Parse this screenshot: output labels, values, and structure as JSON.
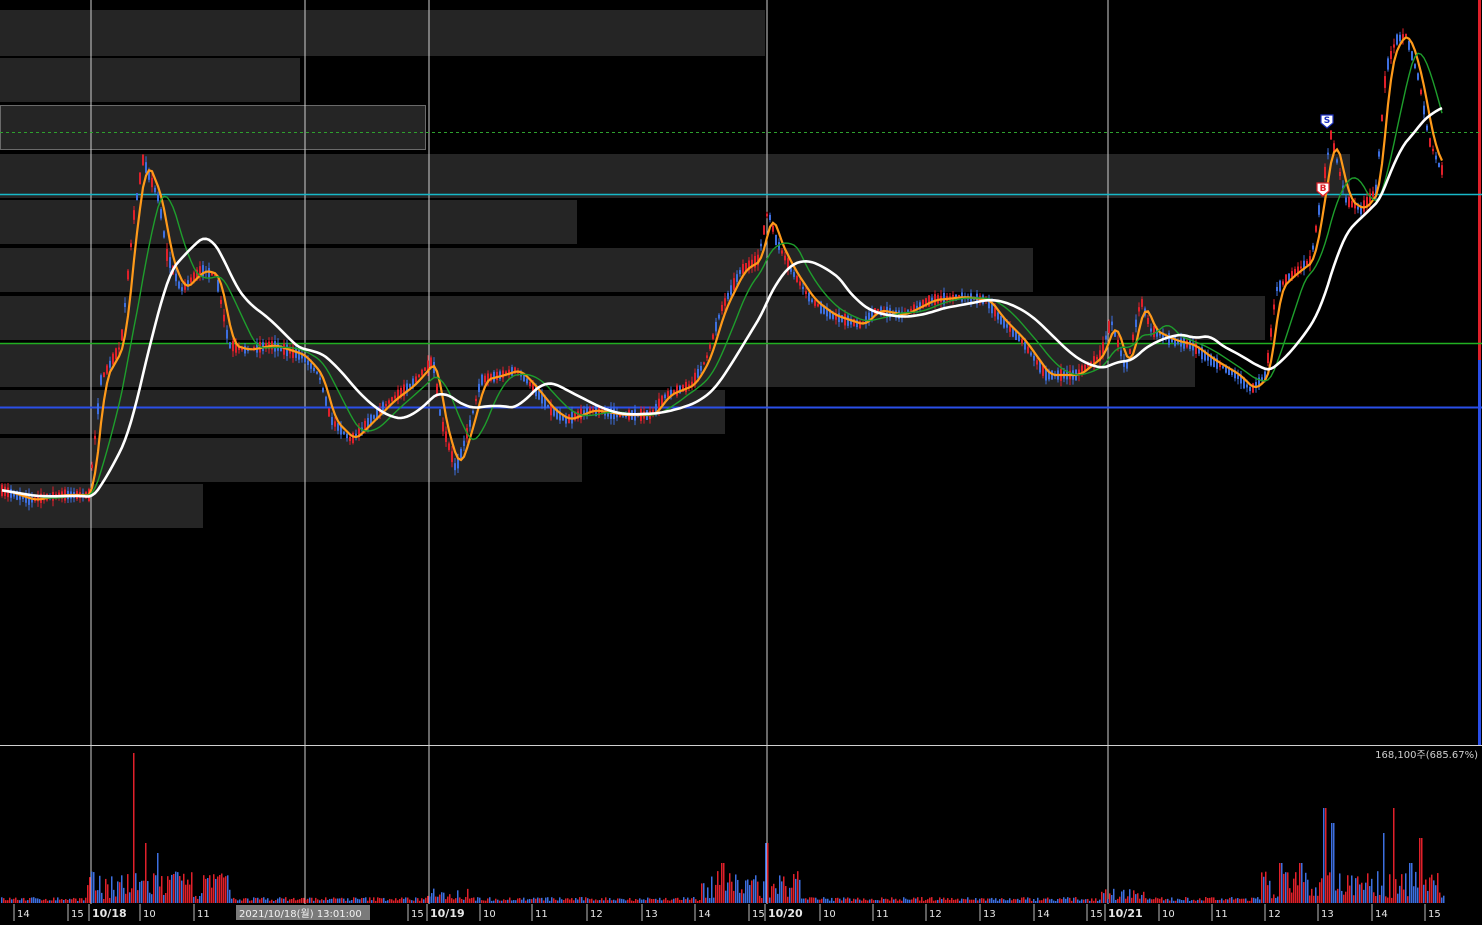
{
  "chart_data": {
    "type": "candlestick",
    "x_axis": {
      "ticks": [
        "14",
        "15",
        "10/18",
        "10",
        "11",
        "15",
        "10/19",
        "10",
        "11",
        "12",
        "13",
        "14",
        "15",
        "10/20",
        "10",
        "11",
        "12",
        "13",
        "14",
        "15",
        "10/21",
        "10",
        "11",
        "12",
        "13",
        "14",
        "15"
      ],
      "day_labels": [
        "10/18",
        "10/19",
        "10/20",
        "10/21"
      ],
      "cursor_label": "2021/10/18(월) 13:01:00"
    },
    "volume_panel": {
      "readout": "168,100주(685.67%)"
    },
    "signals": [
      {
        "label": "S",
        "color": "#1a2fbd"
      },
      {
        "label": "B",
        "color": "#e0202a"
      }
    ],
    "moving_averages": [
      {
        "color": "#ff9a1a"
      },
      {
        "color": "#1e9e2c"
      },
      {
        "color": "#ffffff"
      }
    ],
    "colors": {
      "up": "#e0202a",
      "down": "#3d6fe0",
      "grid": "#d0d0d0",
      "profile_bar": "#252525",
      "current_price_line": "#17b8c8",
      "support_line_green": "#21b021",
      "support_line_blue": "#2a4fe8",
      "dashed_line": "#2ea02e"
    }
  }
}
